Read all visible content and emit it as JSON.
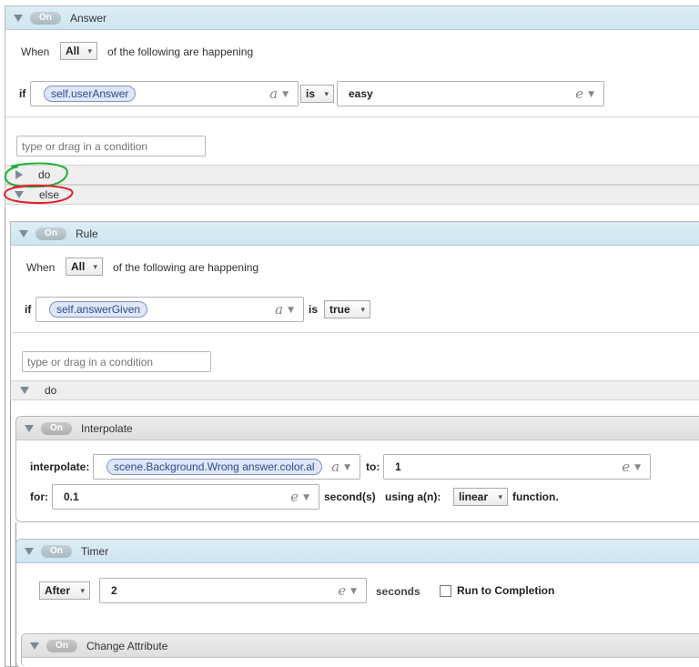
{
  "answer": {
    "toggle": "On",
    "title": "Answer",
    "when_label": "When",
    "mode": "All",
    "following": "of the following are happening",
    "if_label": "if",
    "lhs": "self.userAnswer",
    "lhs_suffix": "a",
    "op": "is",
    "rhs": "easy",
    "rhs_suffix": "e",
    "cond_placeholder": "type or drag in a condition",
    "do_label": "do",
    "else_label": "else"
  },
  "rule": {
    "toggle": "On",
    "title": "Rule",
    "when_label": "When",
    "mode": "All",
    "following": "of the following are happening",
    "if_label": "if",
    "lhs": "self.answerGiven",
    "lhs_suffix": "a",
    "op": "is",
    "rhs": "true",
    "cond_placeholder": "type or drag in a condition",
    "do_label": "do"
  },
  "interpolate": {
    "toggle": "On",
    "title": "Interpolate",
    "interpolate_label": "interpolate:",
    "target": "scene.Background.Wrong answer.color.al",
    "target_suffix": "a",
    "to_label": "to:",
    "to_value": "1",
    "to_suffix": "e",
    "for_label": "for:",
    "for_value": "0.1",
    "for_suffix": "e",
    "seconds_label": "second(s)",
    "using_label": "using a(n):",
    "easing": "linear",
    "function_label": "function."
  },
  "timer": {
    "toggle": "On",
    "title": "Timer",
    "mode": "After",
    "value": "2",
    "suffix": "e",
    "seconds_label": "seconds",
    "run_label": "Run to Completion"
  },
  "change_attribute": {
    "toggle": "On",
    "title": "Change Attribute"
  },
  "annotation_colors": {
    "do_circle": "#22b03a",
    "else_circle": "#e0202a"
  }
}
